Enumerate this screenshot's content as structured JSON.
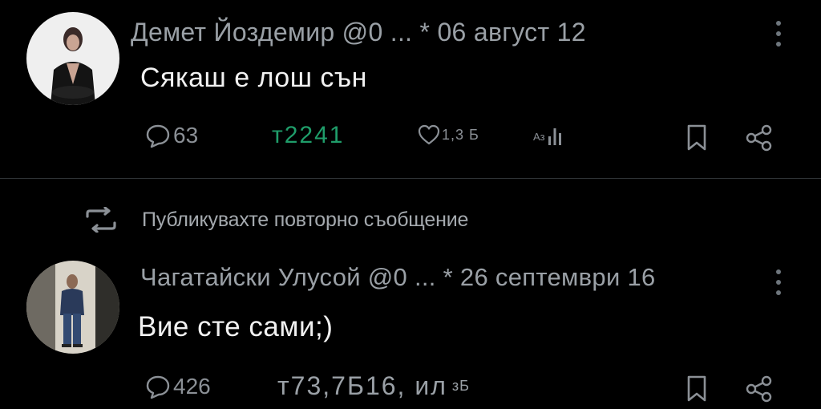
{
  "posts": [
    {
      "author_line": "Демет Йоздемир @0 ... * 06 август 12",
      "text": "Сякаш е лош сън",
      "replies": "63",
      "views": "т2241",
      "likes": "1,3 Б",
      "stats_label": "Аз"
    },
    {
      "repost_note": "Публикувахте повторно съобщение",
      "author_line": "Чагатайски Улусой @0 ... * 26 септември 16",
      "text": "Вие сте сами;)",
      "replies": "426",
      "views": "т73,7Б16, ил",
      "views_suffix": "зБ"
    }
  ],
  "colors": {
    "background": "#000000",
    "text": "#f1f1f1",
    "muted": "#8b9096",
    "views_green": "#1f9d6a"
  },
  "icons": [
    "reply-icon",
    "heart-icon",
    "stats-icon",
    "bookmark-icon",
    "share-icon",
    "more-icon",
    "repost-icon"
  ]
}
